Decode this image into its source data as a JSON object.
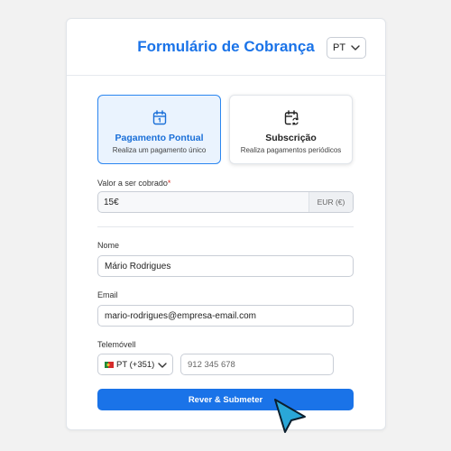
{
  "header": {
    "title": "Formulário de Cobrança",
    "language": "PT"
  },
  "payment_types": [
    {
      "label": "Pagamento Pontual",
      "description": "Realiza um pagamento único",
      "icon": "calendar-icon",
      "selected": true
    },
    {
      "label": "Subscrição",
      "description": "Realiza pagamentos periódicos",
      "icon": "recurring-calendar-icon",
      "selected": false
    }
  ],
  "amount": {
    "label": "Valor a ser cobrado",
    "required_marker": "*",
    "value": "15€",
    "currency": "EUR (€)"
  },
  "name": {
    "label": "Nome",
    "value": "Mário Rodrigues"
  },
  "email": {
    "label": "Email",
    "value": "mario-rodrigues@empresa-email.com"
  },
  "phone": {
    "label": "Telemóvell",
    "country": "PT (+351)",
    "placeholder": "912 345 678"
  },
  "submit": {
    "label": "Rever & Submeter"
  },
  "colors": {
    "accent": "#1a73e8",
    "selected_bg": "#eaf3fe",
    "required": "#d93025",
    "cursor": "#2aa7d8"
  }
}
